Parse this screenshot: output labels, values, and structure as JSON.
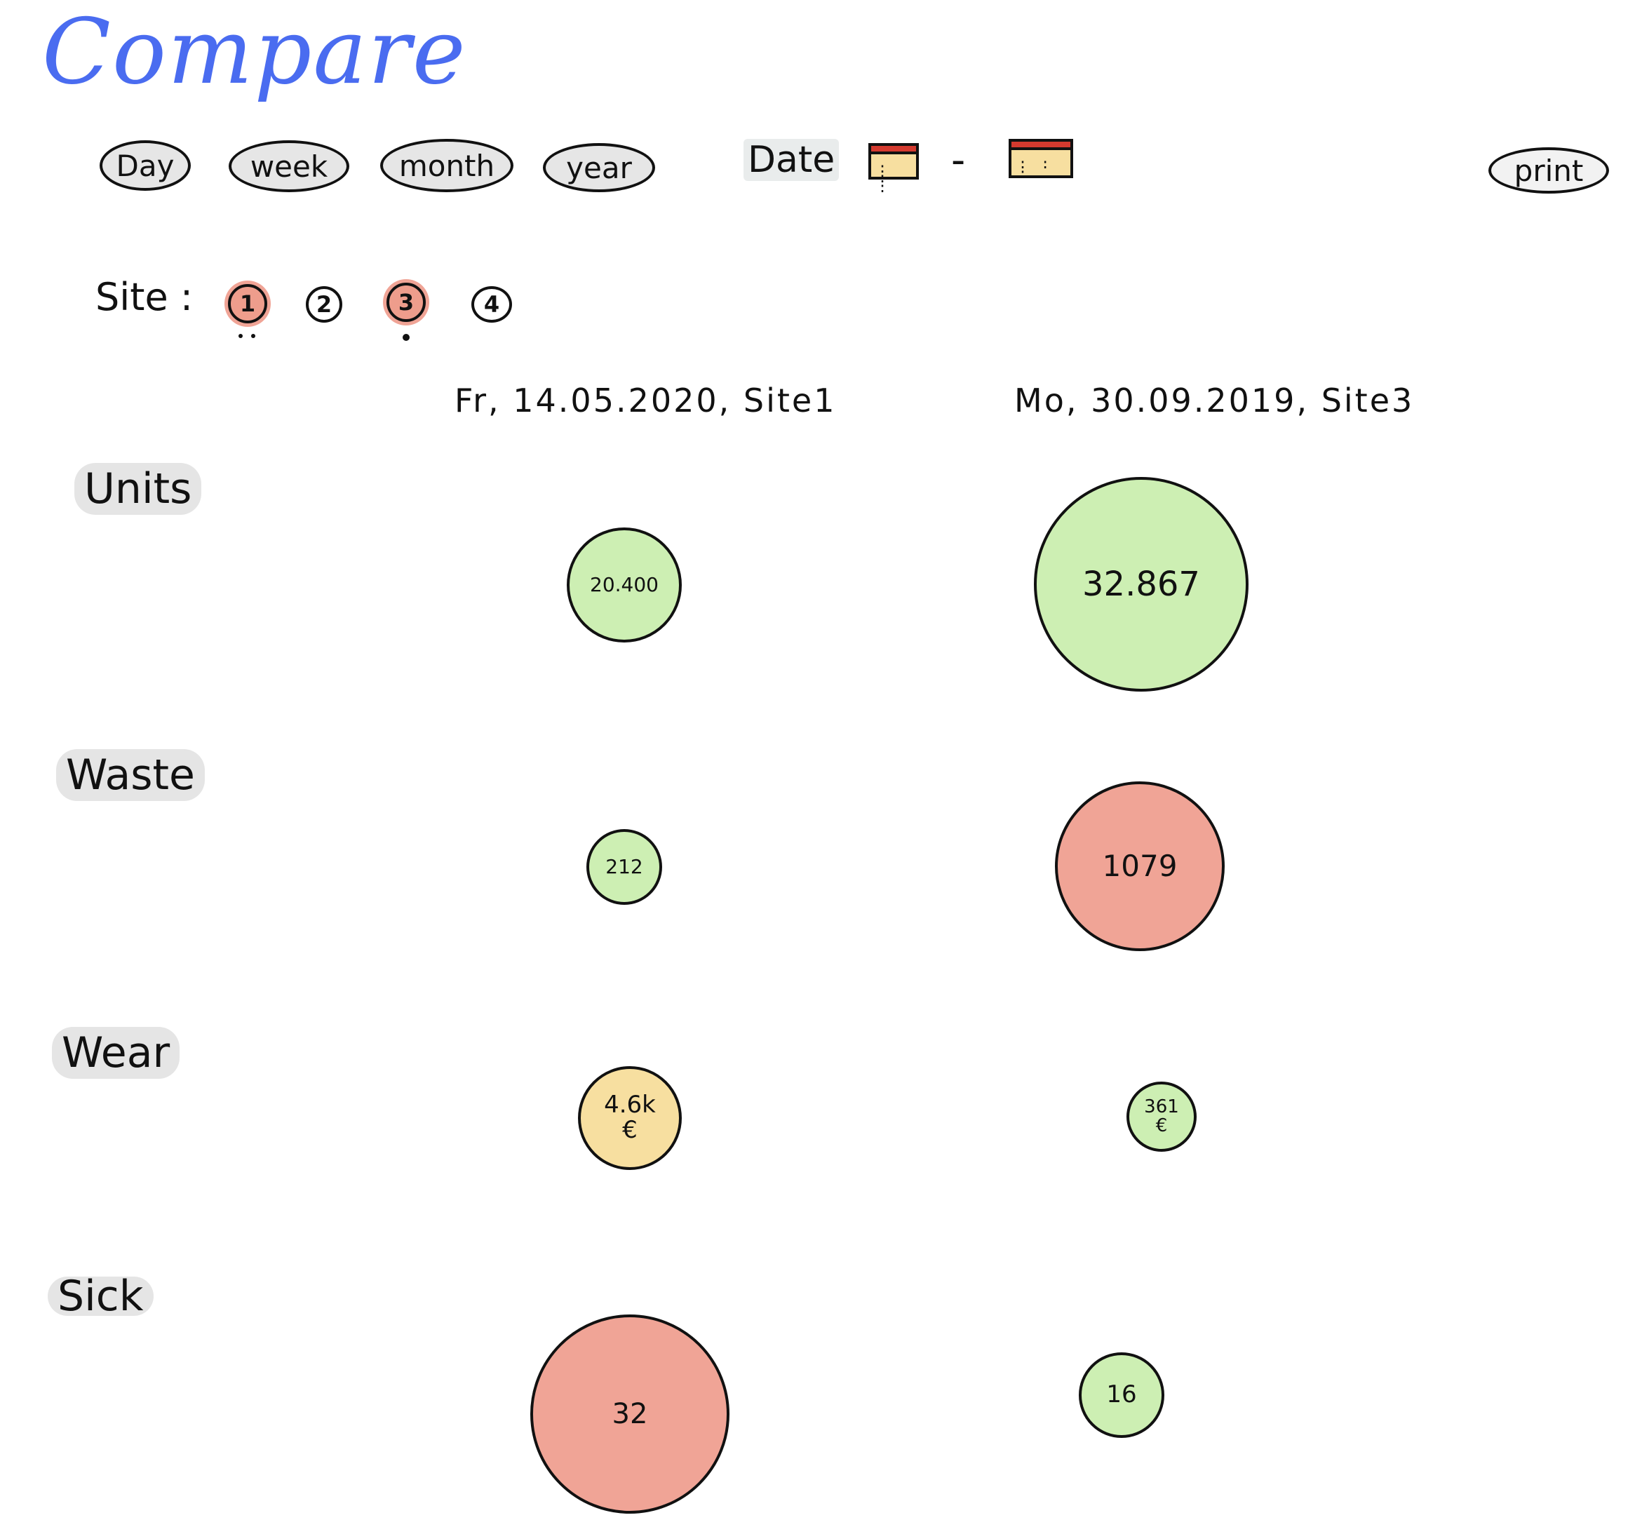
{
  "title": "Compare",
  "periods": [
    "Day",
    "week",
    "month",
    "year"
  ],
  "date": {
    "label": "Date",
    "separator": "-"
  },
  "print_label": "print",
  "site": {
    "label": "Site :",
    "options": [
      "1",
      "2",
      "3",
      "4"
    ],
    "selected": [
      "1",
      "3"
    ]
  },
  "columns": [
    "Fr, 14.05.2020, Site1",
    "Mo, 30.09.2019, Site3"
  ],
  "rows": [
    {
      "label": "Units",
      "values": [
        "20.400",
        "32.867"
      ],
      "units": [
        "",
        ""
      ]
    },
    {
      "label": "Waste",
      "values": [
        "212",
        "1079"
      ],
      "units": [
        "",
        ""
      ]
    },
    {
      "label": "Wear",
      "values": [
        "4.6k",
        "361"
      ],
      "units": [
        "€",
        "€"
      ]
    },
    {
      "label": "Sick",
      "values": [
        "32",
        "16"
      ],
      "units": [
        "",
        ""
      ]
    }
  ],
  "colors": {
    "title": "#4a6cf0",
    "green": "#cdefb3",
    "red": "#f0a496",
    "yellow": "#f7dfa0",
    "calendar_top": "#d43a2f"
  },
  "bubble_status": [
    [
      "green",
      "green"
    ],
    [
      "green",
      "red"
    ],
    [
      "yellow",
      "green"
    ],
    [
      "red",
      "green"
    ]
  ]
}
